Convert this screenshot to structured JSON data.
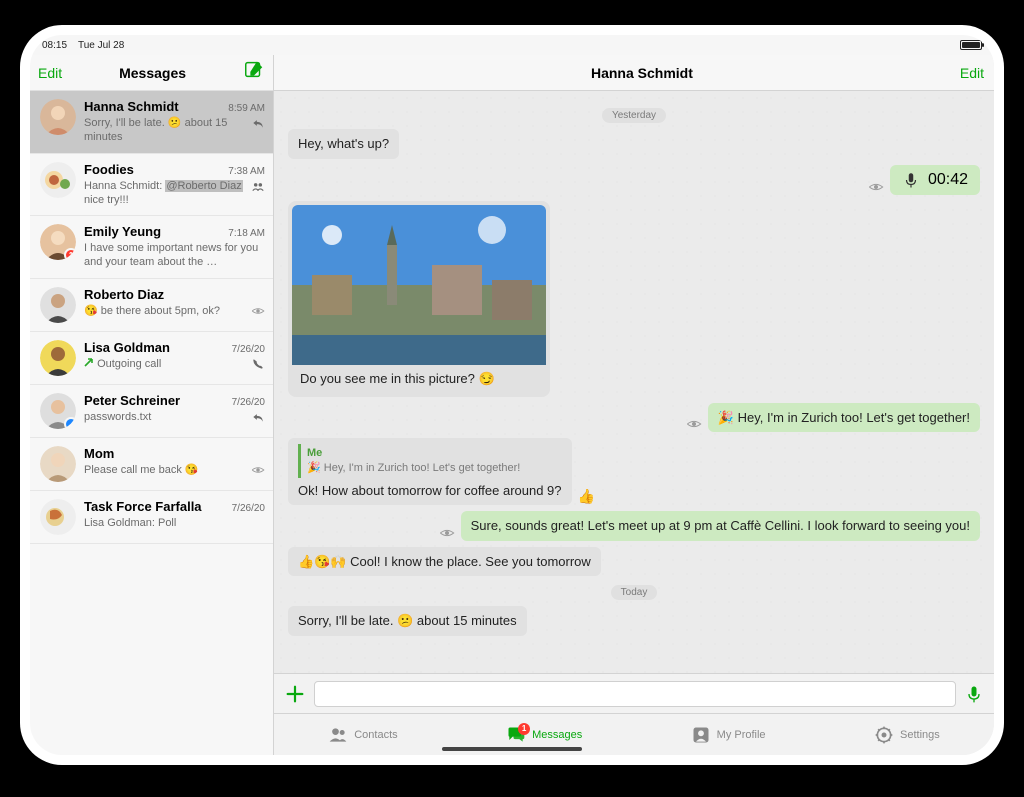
{
  "statusbar": {
    "time": "08:15",
    "date": "Tue Jul 28"
  },
  "sidebar": {
    "edit": "Edit",
    "title": "Messages",
    "conversations": [
      {
        "name": "Hanna Schmidt",
        "time": "8:59 AM",
        "preview_prefix": "Sorry, I'll be late. ",
        "emoji": "😕",
        "preview_suffix": " about 15 minutes",
        "status": "reply",
        "selected": true
      },
      {
        "name": "Foodies",
        "time": "7:38 AM",
        "preview_line1_prefix": "Hanna Schmidt: ",
        "preview_line1_mention": "@Roberto Diaz",
        "preview_line2": "nice try!!!",
        "status": "group"
      },
      {
        "name": "Emily Yeung",
        "time": "7:18 AM",
        "preview": "I have some important news for you and your team about the …",
        "badge": "1"
      },
      {
        "name": "Roberto Diaz",
        "time": "",
        "emoji": "😘",
        "preview": " be there about 5pm, ok?",
        "status": "eye"
      },
      {
        "name": "Lisa Goldman",
        "time": "7/26/20",
        "preview": "Outgoing call",
        "status": "call",
        "call_arrow": true
      },
      {
        "name": "Peter Schreiner",
        "time": "7/26/20",
        "preview": "passwords.txt",
        "status": "reply",
        "badge_blue": true
      },
      {
        "name": "Mom",
        "time": "",
        "preview": "Please call me back ",
        "emoji_end": "😘",
        "status": "eye"
      },
      {
        "name": "Task Force Farfalla",
        "time": "7/26/20",
        "preview": "Lisa Goldman: Poll"
      }
    ]
  },
  "chat": {
    "title": "Hanna Schmidt",
    "edit": "Edit",
    "divider1": "Yesterday",
    "divider2": "Today",
    "m1": "Hey, what's up?",
    "voice_duration": "00:42",
    "m2_caption": "Do you see me in this picture? 😏",
    "m3": "🎉 Hey, I'm in Zurich too!  Let's get together!",
    "m4_quote_name": "Me",
    "m4_quote_text": "🎉 Hey, I'm in Zurich too!  Let's get together!",
    "m4": "Ok! How about tomorrow for coffee around 9?",
    "m5": "Sure, sounds great! Let's meet up at 9 pm at Caffè Cellini. I look forward to seeing you!",
    "m6": "👍😘🙌 Cool! I know the place. See you tomorrow",
    "m7": "Sorry, I'll be late. 😕 about 15 minutes"
  },
  "composer": {
    "placeholder": ""
  },
  "tabs": {
    "contacts": "Contacts",
    "messages": "Messages",
    "messages_badge": "1",
    "profile": "My Profile",
    "settings": "Settings"
  }
}
